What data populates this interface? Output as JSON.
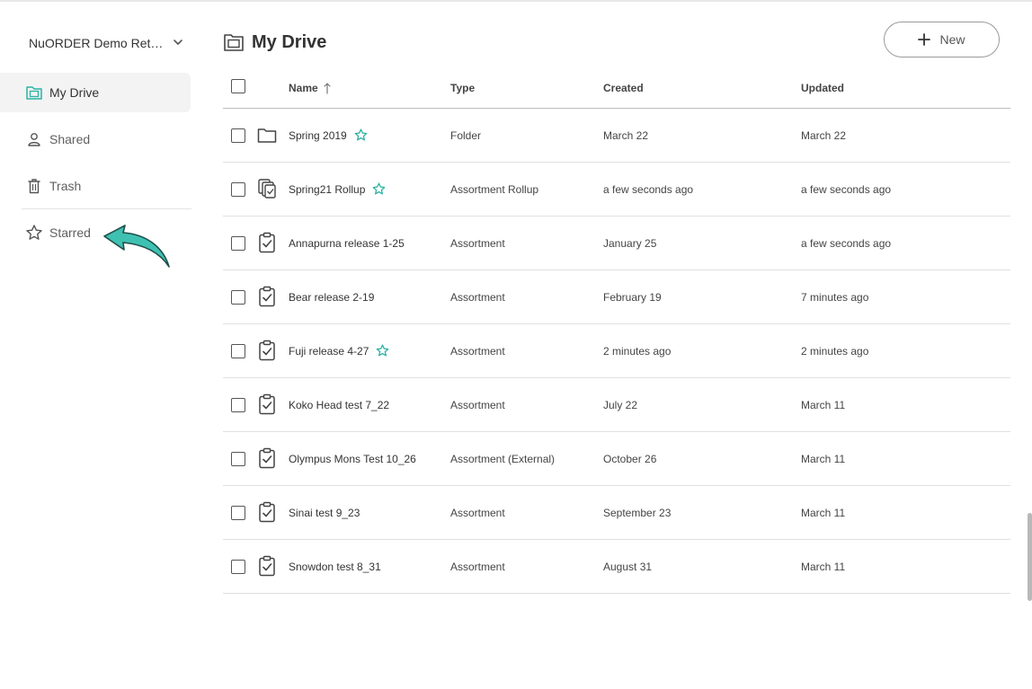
{
  "sidebar": {
    "org_name": "NuORDER Demo Reta...",
    "items": [
      {
        "label": "My Drive",
        "icon": "drive-folder-icon"
      },
      {
        "label": "Shared",
        "icon": "person-icon"
      },
      {
        "label": "Trash",
        "icon": "trash-icon"
      },
      {
        "label": "Starred",
        "icon": "star-outline-icon"
      }
    ]
  },
  "header": {
    "title": "My Drive",
    "new_label": "New"
  },
  "table": {
    "columns": [
      "Name",
      "Type",
      "Created",
      "Updated"
    ],
    "sort": {
      "column": "Name",
      "direction": "ascending"
    },
    "rows": [
      {
        "name": "Spring 2019",
        "starred": true,
        "icon": "folder-icon",
        "type": "Folder",
        "created": "March 22",
        "updated": "March 22"
      },
      {
        "name": "Spring21 Rollup",
        "starred": true,
        "icon": "rollup-icon",
        "type": "Assortment Rollup",
        "created": "a few seconds ago",
        "updated": "a few seconds ago"
      },
      {
        "name": "Annapurna release 1-25",
        "starred": false,
        "icon": "clipboard-check-icon",
        "type": "Assortment",
        "created": "January 25",
        "updated": "a few seconds ago"
      },
      {
        "name": "Bear release 2-19",
        "starred": false,
        "icon": "clipboard-check-icon",
        "type": "Assortment",
        "created": "February 19",
        "updated": "7 minutes ago"
      },
      {
        "name": "Fuji release 4-27",
        "starred": true,
        "icon": "clipboard-check-icon",
        "type": "Assortment",
        "created": "2 minutes ago",
        "updated": "2 minutes ago"
      },
      {
        "name": "Koko Head test 7_22",
        "starred": false,
        "icon": "clipboard-check-icon",
        "type": "Assortment",
        "created": "July 22",
        "updated": "March 11"
      },
      {
        "name": "Olympus Mons Test 10_26",
        "starred": false,
        "icon": "clipboard-check-icon",
        "type": "Assortment (External)",
        "created": "October 26",
        "updated": "March 11"
      },
      {
        "name": "Sinai test 9_23",
        "starred": false,
        "icon": "clipboard-check-icon",
        "type": "Assortment",
        "created": "September 23",
        "updated": "March 11"
      },
      {
        "name": "Snowdon test 8_31",
        "starred": false,
        "icon": "clipboard-check-icon",
        "type": "Assortment",
        "created": "August 31",
        "updated": "March 11"
      }
    ]
  },
  "colors": {
    "accent": "#2bb3a3",
    "arrow_fill": "#3fc1b2",
    "text": "#333333",
    "muted": "#5f5f5f"
  }
}
